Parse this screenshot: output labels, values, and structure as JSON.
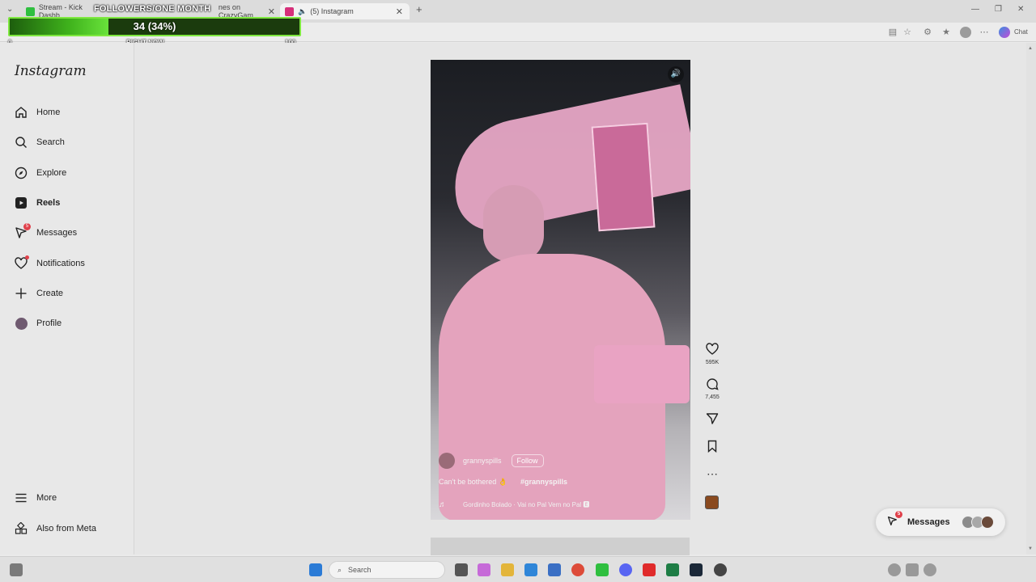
{
  "browser": {
    "tabs": [
      {
        "title": "Stream - Kick Dashb",
        "favicon_color": "#2fbf3f"
      },
      {
        "title": "nes on CrazyGam",
        "favicon_color": "#7b55c8"
      },
      {
        "title": "(5) Instagram",
        "favicon_color": "#d6307a",
        "active": true
      }
    ],
    "new_tab_icon": "plus-icon",
    "chat_label": "Chat"
  },
  "overlay": {
    "title": "FOLLOWERS/ONE MONTH",
    "progress_text": "34 (34%)",
    "progress_fraction": 0.34,
    "min_label": "0",
    "center_label": "RIGHT NOW",
    "max_label": "100"
  },
  "sidebar": {
    "logo": "Instagram",
    "items": [
      {
        "label": "Home",
        "icon": "home-icon"
      },
      {
        "label": "Search",
        "icon": "search-icon"
      },
      {
        "label": "Explore",
        "icon": "compass-icon"
      },
      {
        "label": "Reels",
        "icon": "reels-icon",
        "active": true
      },
      {
        "label": "Messages",
        "icon": "messenger-icon",
        "badge": "5"
      },
      {
        "label": "Notifications",
        "icon": "heart-icon"
      },
      {
        "label": "Create",
        "icon": "plus-icon"
      },
      {
        "label": "Profile",
        "icon": "avatar"
      }
    ],
    "more_label": "More",
    "meta_label": "Also from Meta"
  },
  "reel": {
    "username": "grannyspills",
    "follow_label": "Follow",
    "caption": "Can't be bothered 👌",
    "hashtag": "#grannyspills",
    "music": "Gordinho Bolado · Vai no Pal Vem no Pal 🅴"
  },
  "actions": {
    "likes": "595K",
    "comments": "7,455"
  },
  "messages_pill": {
    "label": "Messages",
    "badge": "5"
  },
  "taskbar": {
    "search_placeholder": "Search"
  }
}
